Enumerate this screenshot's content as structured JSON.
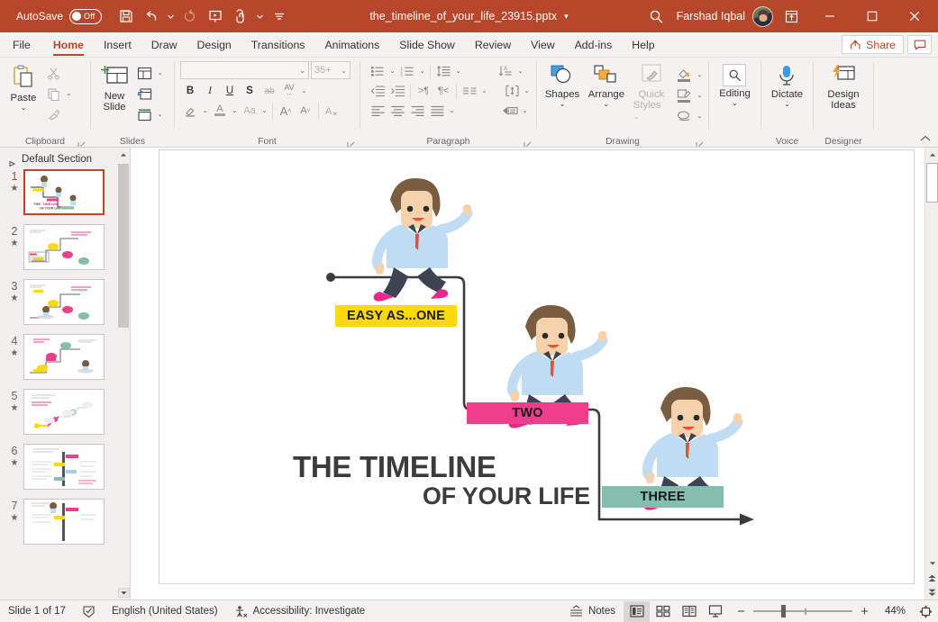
{
  "titlebar": {
    "autosave_label": "AutoSave",
    "autosave_state": "Off",
    "doc_title": "the_timeline_of_your_life_23915.pptx",
    "user_name": "Farshad Iqbal",
    "qat": [
      {
        "name": "save-icon",
        "tip": "Save"
      },
      {
        "name": "undo-icon",
        "tip": "Undo"
      },
      {
        "name": "redo-icon",
        "tip": "Redo"
      },
      {
        "name": "start-presentation-icon",
        "tip": "Start From Beginning"
      },
      {
        "name": "touch-mode-icon",
        "tip": "Touch/Mouse Mode"
      },
      {
        "name": "customize-qat-icon",
        "tip": "Customize Quick Access Toolbar"
      }
    ],
    "window_buttons": [
      "minimize",
      "maximize",
      "close"
    ]
  },
  "tabs": [
    {
      "label": "File",
      "active": false
    },
    {
      "label": "Home",
      "active": true
    },
    {
      "label": "Insert",
      "active": false
    },
    {
      "label": "Draw",
      "active": false
    },
    {
      "label": "Design",
      "active": false
    },
    {
      "label": "Transitions",
      "active": false
    },
    {
      "label": "Animations",
      "active": false
    },
    {
      "label": "Slide Show",
      "active": false
    },
    {
      "label": "Review",
      "active": false
    },
    {
      "label": "View",
      "active": false
    },
    {
      "label": "Add-ins",
      "active": false
    },
    {
      "label": "Help",
      "active": false
    }
  ],
  "tabbar_right": {
    "share_label": "Share",
    "comments_tip": "Comments"
  },
  "ribbon": {
    "groups": [
      {
        "label": "Clipboard"
      },
      {
        "label": "Slides"
      },
      {
        "label": "Font"
      },
      {
        "label": "Paragraph"
      },
      {
        "label": "Drawing"
      },
      {
        "label": "Voice"
      },
      {
        "label": "Designer"
      }
    ],
    "clipboard": {
      "paste_label": "Paste",
      "cut_tip": "Cut",
      "copy_tip": "Copy",
      "format_painter_tip": "Format Painter"
    },
    "slides": {
      "new_slide_label": "New\nSlide",
      "new_slide_line1": "New",
      "new_slide_line2": "Slide",
      "layout_tip": "Layout",
      "reset_tip": "Reset",
      "section_tip": "Section"
    },
    "font": {
      "font_name_value": "",
      "font_size_value": "35+",
      "bold": "B",
      "italic": "I",
      "underline": "U",
      "shadow": "S",
      "strikethrough": "ab",
      "char_spacing": "AV",
      "text_highlight_tip": "Text Highlight Color",
      "font_color_tip": "Font Color",
      "change_case": "Aa",
      "increase_size": "A",
      "decrease_size": "A",
      "clear_formatting_tip": "Clear All Formatting"
    },
    "paragraph": {
      "bullets_tip": "Bullets",
      "numbering_tip": "Numbering",
      "line_spacing_tip": "Line Spacing",
      "text_direction_tip": "Text Direction",
      "decrease_indent_tip": "Decrease List Level",
      "increase_indent_tip": "Increase List Level",
      "align_left_tip": "Align Left",
      "center_tip": "Center",
      "align_right_tip": "Align Right",
      "justify_tip": "Justify",
      "columns_tip": "Add or Remove Columns",
      "align_text_tip": "Align Text",
      "smartart_tip": "Convert to SmartArt"
    },
    "drawing": {
      "shapes_label": "Shapes",
      "arrange_label": "Arrange",
      "quick_styles_line1": "Quick",
      "quick_styles_line2": "Styles",
      "shape_fill_tip": "Shape Fill",
      "shape_outline_tip": "Shape Outline",
      "shape_effects_tip": "Shape Effects"
    },
    "editing": {
      "label": "Editing"
    },
    "voice": {
      "dictate_label": "Dictate"
    },
    "designer": {
      "design_ideas_line1": "Design",
      "design_ideas_line2": "Ideas"
    },
    "collapse_tip": "Collapse the Ribbon"
  },
  "thumbnails": {
    "section_name": "Default Section",
    "slides": [
      {
        "num": "1",
        "selected": true
      },
      {
        "num": "2",
        "selected": false
      },
      {
        "num": "3",
        "selected": false
      },
      {
        "num": "4",
        "selected": false
      },
      {
        "num": "5",
        "selected": false
      },
      {
        "num": "6",
        "selected": false
      },
      {
        "num": "7",
        "selected": false
      }
    ],
    "star_glyph": "★"
  },
  "slide": {
    "steps": [
      {
        "label": "EASY AS...ONE",
        "color": "#fcd90b"
      },
      {
        "label": "TWO",
        "color": "#ee3d8b"
      },
      {
        "label": "THREE",
        "color": "#85bdae"
      }
    ],
    "title": {
      "line1_part1": "THE ",
      "line1_part2": "TIMELINE",
      "line2_part1": "OF YOUR ",
      "line2_part2": "LIFE"
    },
    "colors": {
      "yellow": "#fcd90b",
      "pink": "#ee3d8b",
      "teal": "#85bdae",
      "title_pink": "#ec268f",
      "title_dark": "#3c3c3c"
    }
  },
  "statusbar": {
    "slide_counter": "Slide 1 of 17",
    "language": "English (United States)",
    "accessibility": "Accessibility: Investigate",
    "notes_label": "Notes",
    "views": [
      {
        "name": "normal-view",
        "active": true
      },
      {
        "name": "slide-sorter-view",
        "active": false
      },
      {
        "name": "reading-view",
        "active": false
      },
      {
        "name": "slide-show-view",
        "active": false
      }
    ],
    "zoom_percent": "44%",
    "zoom_out": "−",
    "zoom_in": "+",
    "fit_slide_tip": "Fit slide to current window"
  }
}
